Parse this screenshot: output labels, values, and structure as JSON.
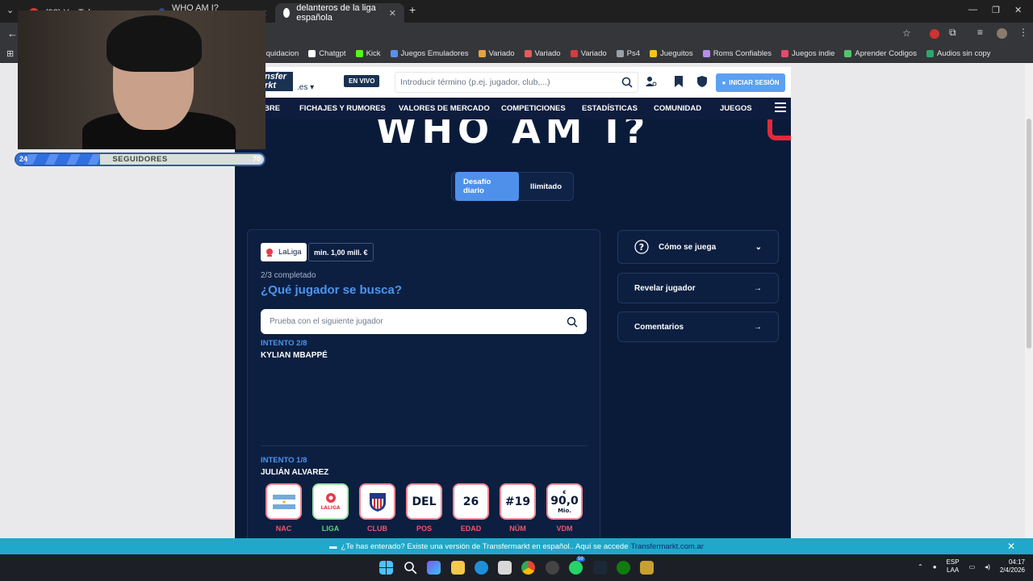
{
  "browser": {
    "tabs": [
      {
        "label": "(93) YouTube"
      },
      {
        "label": "WHO AM I? Transfermarkt"
      },
      {
        "label": "delanteros de la liga española"
      }
    ],
    "bookmarks": [
      {
        "label": "Liquidacion",
        "color": "#9aa0a6"
      },
      {
        "label": "Chatgpt",
        "color": "#ffffff"
      },
      {
        "label": "Kick",
        "color": "#53fc18"
      },
      {
        "label": "Juegos Emuladores",
        "color": "#5a8ff0"
      },
      {
        "label": "Variado",
        "color": "#e8a23a"
      },
      {
        "label": "Variado",
        "color": "#e85a5a"
      },
      {
        "label": "Variado",
        "color": "#d83b3b"
      },
      {
        "label": "Ps4",
        "color": "#9aa0a6"
      },
      {
        "label": "Jueguitos",
        "color": "#f5c518"
      },
      {
        "label": "Roms Confiables",
        "color": "#b58cf0"
      },
      {
        "label": "Juegos indie",
        "color": "#e84a6a"
      },
      {
        "label": "Aprender Codigos",
        "color": "#53c46a"
      },
      {
        "label": "Audios sin copy",
        "color": "#2aa86a"
      }
    ]
  },
  "header": {
    "logo_text": "nsfer rkt",
    "logo_suffix": ".es",
    "live_label": "EN VIVO",
    "search_placeholder": "Introducir término (p.ej. jugador, club,...)",
    "login_label": "INICIAR SESIÓN"
  },
  "nav": {
    "items": [
      "BRE",
      "FICHAJES Y RUMORES",
      "VALORES DE MERCADO",
      "COMPETICIONES",
      "ESTADÍSTICAS",
      "COMUNIDAD",
      "JUEGOS"
    ]
  },
  "game": {
    "title": "WHO AM I?",
    "modes": [
      {
        "label": "Desafío diario",
        "active": true
      },
      {
        "label": "Ilimitado",
        "active": false
      }
    ],
    "league_pill": "LaLiga",
    "value_pill": "min. 1,00 mill. €",
    "progress": "2/3 completado",
    "question": "¿Qué jugador se busca?",
    "input_placeholder": "Prueba con el siguiente jugador",
    "attempts": [
      {
        "label": "INTENTO 2/8",
        "name": "KYLIAN MBAPPÉ"
      },
      {
        "label": "INTENTO 1/8",
        "name": "JULIÁN ALVAREZ"
      }
    ],
    "clues": [
      {
        "label": "NAC",
        "value": "",
        "icon": "argentina-flag-icon",
        "match": false
      },
      {
        "label": "LIGA",
        "value": "LALIGA",
        "icon": "laliga-icon",
        "match": true
      },
      {
        "label": "CLUB",
        "value": "",
        "icon": "atletico-madrid-crest-icon",
        "match": false
      },
      {
        "label": "POS",
        "value": "DEL",
        "match": false
      },
      {
        "label": "EDAD",
        "value": "26",
        "match": false
      },
      {
        "label": "NÚM",
        "value": "#19",
        "match": false
      },
      {
        "label": "VDM",
        "value_top": "€",
        "value": "90,0",
        "value_bottom": "Mio.",
        "match": false
      }
    ],
    "side": {
      "how_to_play": "Cómo se juega",
      "reveal": "Revelar jugador",
      "comments": "Comentarios"
    }
  },
  "infobar": {
    "text": "¿Te has enterado? Existe una versión de Transfermarkt en español.. Aquí se accede",
    "link": "Transfermarkt.com.ar"
  },
  "overlay": {
    "followers_label": "SEGUIDORES",
    "followers_current": "24",
    "followers_goal": "70",
    "progress_fraction": 0.34
  },
  "taskbar": {
    "lang_top": "ESP",
    "lang_bottom": "LAA",
    "time": "04:17",
    "date": "2/4/2026",
    "whatsapp_badge": "59"
  }
}
